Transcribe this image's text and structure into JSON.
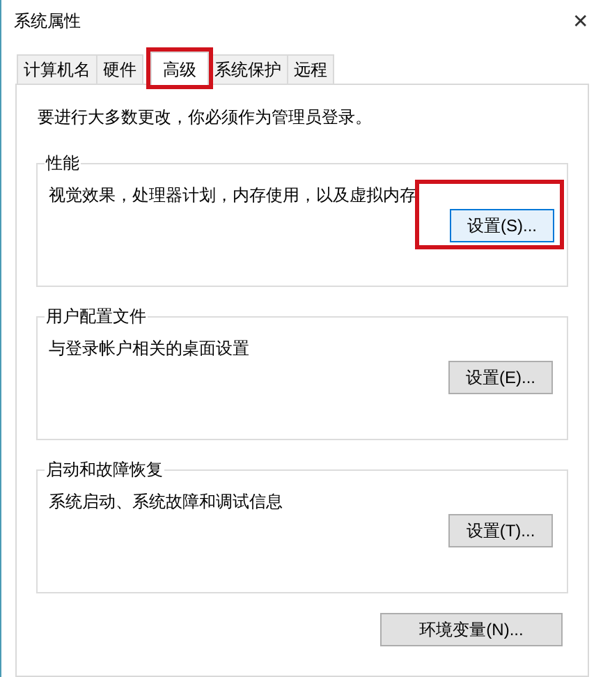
{
  "window": {
    "title": "系统属性",
    "close": "✕"
  },
  "tabs": [
    {
      "label": "计算机名",
      "selected": false,
      "highlighted": false
    },
    {
      "label": "硬件",
      "selected": false,
      "highlighted": false
    },
    {
      "label": "高级",
      "selected": true,
      "highlighted": true
    },
    {
      "label": "系统保护",
      "selected": false,
      "highlighted": false
    },
    {
      "label": "远程",
      "selected": false,
      "highlighted": false
    }
  ],
  "notice": "要进行大多数更改，你必须作为管理员登录。",
  "groups": [
    {
      "title": "性能",
      "description": "视觉效果，处理器计划，内存使用，以及虚拟内存",
      "button": {
        "label": "设置(S)...",
        "hovered": true,
        "highlighted": true
      }
    },
    {
      "title": "用户配置文件",
      "description": "与登录帐户相关的桌面设置",
      "button": {
        "label": "设置(E)...",
        "hovered": false,
        "highlighted": false
      }
    },
    {
      "title": "启动和故障恢复",
      "description": "系统启动、系统故障和调试信息",
      "button": {
        "label": "设置(T)...",
        "hovered": false,
        "highlighted": false
      }
    }
  ],
  "env_button": {
    "label": "环境变量(N)...",
    "hovered": false,
    "highlighted": false
  }
}
